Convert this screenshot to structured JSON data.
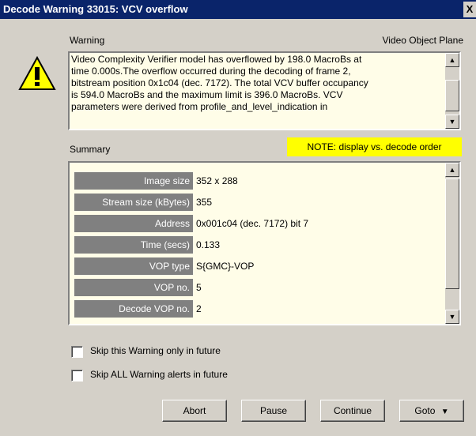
{
  "window": {
    "title": "Decode Warning 33015: VCV overflow",
    "close_glyph": "X"
  },
  "header": {
    "warning_label": "Warning",
    "category_label": "Video Object Plane"
  },
  "message": {
    "text": "Video Complexity Verifier model has overflowed by 198.0 MacroBs at\ntime 0.000s.The overflow occurred during the decoding of frame 2,\nbitstream position 0x1c04 (dec. 7172).  The total VCV buffer occupancy\nis 594.0 MacroBs and the maximum limit is 396.0 MacroBs.  VCV\nparameters were derived from profile_and_level_indication in"
  },
  "summary": {
    "label": "Summary",
    "note": "NOTE: display vs. decode order",
    "rows": [
      {
        "key": "Image size",
        "value": "352 x 288"
      },
      {
        "key": "Stream size (kBytes)",
        "value": "355"
      },
      {
        "key": "Address",
        "value": "0x001c04 (dec. 7172) bit 7"
      },
      {
        "key": "Time (secs)",
        "value": "0.133"
      },
      {
        "key": "VOP type",
        "value": "S{GMC}-VOP"
      },
      {
        "key": "VOP no.",
        "value": "5"
      },
      {
        "key": "Decode VOP no.",
        "value": "2"
      }
    ]
  },
  "options": {
    "skip_this": "Skip this Warning only in future",
    "skip_all": "Skip ALL Warning alerts in future"
  },
  "buttons": {
    "abort": "Abort",
    "pause": "Pause",
    "continue": "Continue",
    "goto": "Goto"
  },
  "colors": {
    "titlebar": "#0a246a",
    "dialog": "#d4d0c8",
    "note_bg": "#ffff00",
    "field_bg": "#fffde8",
    "key_bg": "#808080"
  },
  "icons": {
    "warning": "warning-triangle-icon"
  }
}
